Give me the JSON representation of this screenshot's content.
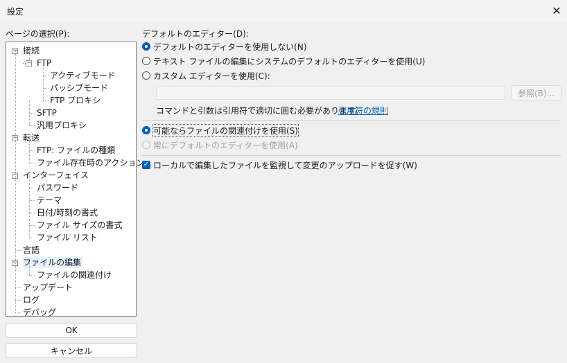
{
  "window": {
    "title": "設定",
    "close_icon": "close-icon"
  },
  "sidebar": {
    "label": "ページの選択(P):",
    "tree": [
      {
        "label": "接続",
        "level": 0,
        "toggle": "-"
      },
      {
        "label": "FTP",
        "level": 1,
        "toggle": "-"
      },
      {
        "label": "アクティブモード",
        "level": 2
      },
      {
        "label": "パッシブモード",
        "level": 2
      },
      {
        "label": "FTP プロキシ",
        "level": 2
      },
      {
        "label": "SFTP",
        "level": 1
      },
      {
        "label": "汎用プロキシ",
        "level": 1
      },
      {
        "label": "転送",
        "level": 0,
        "toggle": "-"
      },
      {
        "label": "FTP: ファイルの種類",
        "level": 1
      },
      {
        "label": "ファイル存在時のアクション",
        "level": 1
      },
      {
        "label": "インターフェイス",
        "level": 0,
        "toggle": "-"
      },
      {
        "label": "パスワード",
        "level": 1
      },
      {
        "label": "テーマ",
        "level": 1
      },
      {
        "label": "日付/時刻の書式",
        "level": 1
      },
      {
        "label": "ファイル サイズの書式",
        "level": 1
      },
      {
        "label": "ファイル リスト",
        "level": 1
      },
      {
        "label": "言語",
        "level": 0
      },
      {
        "label": "ファイルの編集",
        "level": 0,
        "toggle": "-",
        "selected": true
      },
      {
        "label": "ファイルの関連付け",
        "level": 1
      },
      {
        "label": "アップデート",
        "level": 0
      },
      {
        "label": "ログ",
        "level": 0
      },
      {
        "label": "デバッグ",
        "level": 0
      }
    ],
    "ok_label": "OK",
    "cancel_label": "キャンセル"
  },
  "main": {
    "default_editor_label": "デフォルトのエディター(D):",
    "options": [
      {
        "label": "デフォルトのエディターを使用しない(N)",
        "checked": true
      },
      {
        "label": "テキスト ファイルの編集にシステムのデフォルトのエディターを使用(U)",
        "checked": false
      },
      {
        "label": "カスタム エディターを使用(C):",
        "checked": false
      }
    ],
    "custom_editor_value": "",
    "browse_label": "参照(B)...",
    "quote_note": "コマンドと引数は引用符で適切に囲む必要があります。",
    "quote_link": "引用符の規則",
    "assoc_options": [
      {
        "label": "可能ならファイルの関連付けを使用(S)",
        "checked": true,
        "disabled": false
      },
      {
        "label": "常にデフォルトのエディターを使用(A)",
        "checked": false,
        "disabled": true
      }
    ],
    "watch_label": "ローカルで編集したファイルを監視して変更のアップロードを促す(W)",
    "watch_checked": true
  }
}
